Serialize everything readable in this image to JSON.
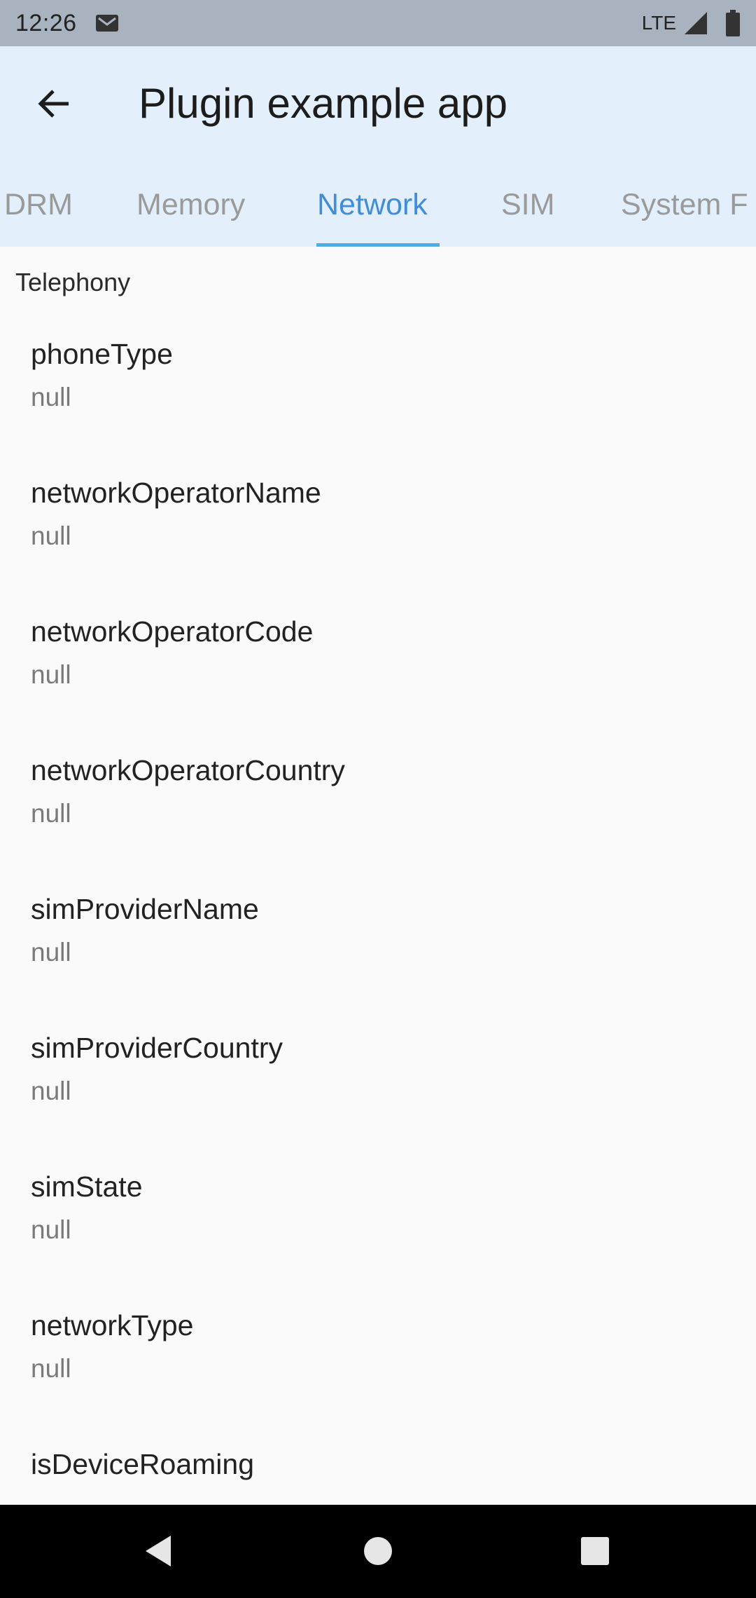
{
  "status_bar": {
    "time": "12:26",
    "network_label": "LTE"
  },
  "app_bar": {
    "title": "Plugin example app",
    "tabs": [
      {
        "label": "DRM"
      },
      {
        "label": "Memory"
      },
      {
        "label": "Network",
        "active": true
      },
      {
        "label": "SIM"
      },
      {
        "label": "System F"
      }
    ]
  },
  "content": {
    "section_title": "Telephony",
    "items": [
      {
        "key": "phoneType",
        "value": "null"
      },
      {
        "key": "networkOperatorName",
        "value": "null"
      },
      {
        "key": "networkOperatorCode",
        "value": "null"
      },
      {
        "key": "networkOperatorCountry",
        "value": "null"
      },
      {
        "key": "simProviderName",
        "value": "null"
      },
      {
        "key": "simProviderCountry",
        "value": "null"
      },
      {
        "key": "simState",
        "value": "null"
      },
      {
        "key": "networkType",
        "value": "null"
      },
      {
        "key": "isDeviceRoaming",
        "value": ""
      }
    ]
  },
  "icons": {
    "back": "arrow-left-icon",
    "mail": "gmail-icon",
    "signal": "signal-icon",
    "battery": "battery-icon",
    "nav_back": "triangle-back-icon",
    "nav_home": "circle-home-icon",
    "nav_recents": "square-recents-icon"
  },
  "colors": {
    "status_bar": "#a8b3bf",
    "app_bar": "#e3f0fb",
    "active_tab": "#3d8ee0",
    "tab_indicator": "#3fb3ef",
    "inactive_tab": "#9a9a9a",
    "background": "#fafafa",
    "nav_bar": "#000000"
  }
}
